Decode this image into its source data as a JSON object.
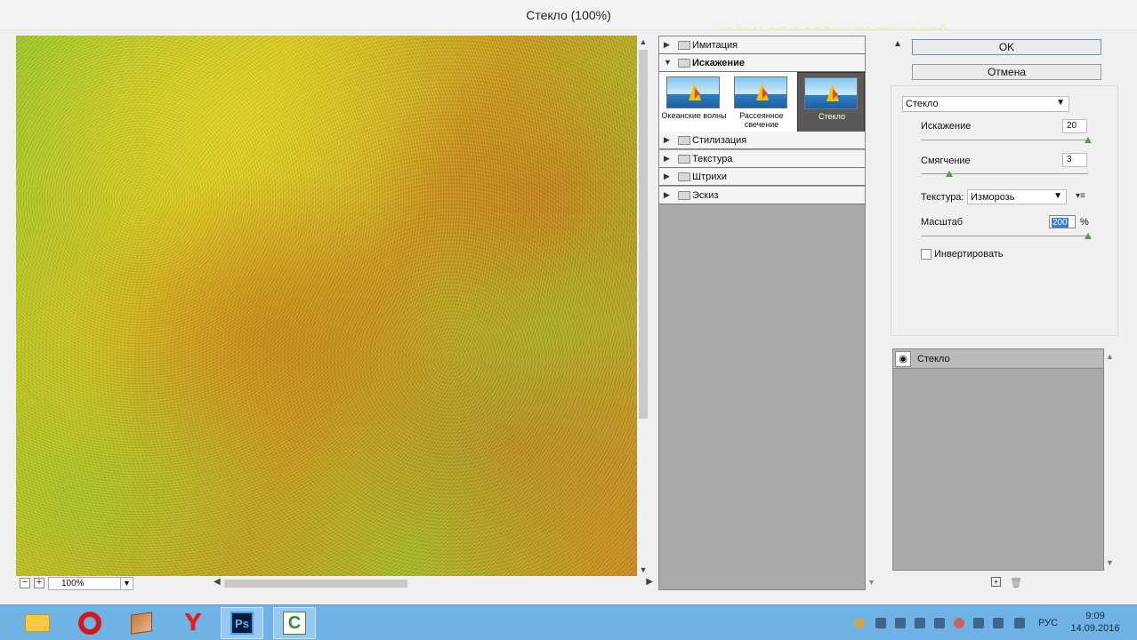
{
  "window": {
    "title": "Стекло (100%)",
    "watermark": "УРОКИ ОТ ЛЮБОВИ ТАРТАНОВОЙ"
  },
  "preview": {
    "zoom": "100%",
    "zoom_out": "−",
    "zoom_in": "+"
  },
  "gallery": {
    "categories": [
      {
        "label": "Имитация",
        "open": false
      },
      {
        "label": "Искажение",
        "open": true
      },
      {
        "label": "Стилизация",
        "open": false
      },
      {
        "label": "Текстура",
        "open": false
      },
      {
        "label": "Штрихи",
        "open": false
      },
      {
        "label": "Эскиз",
        "open": false
      }
    ],
    "thumbnails": [
      {
        "label": "Океанские волны"
      },
      {
        "label": "Рассеянное свечение"
      },
      {
        "label": "Стекло",
        "selected": true
      }
    ]
  },
  "buttons": {
    "ok": "OK",
    "cancel": "Отмена"
  },
  "settings": {
    "filter": "Стекло",
    "distortion_label": "Искажение",
    "distortion_value": "20",
    "distortion_level": 1.0,
    "smoothness_label": "Смягчение",
    "smoothness_value": "3",
    "smoothness_level": 0.15,
    "texture_label": "Текстура:",
    "texture_value": "Изморозь",
    "scale_label": "Масштаб",
    "scale_value": "200",
    "scale_unit": "%",
    "scale_level": 1.0,
    "invert_label": "Инвертировать",
    "invert_checked": false
  },
  "layers": {
    "items": [
      {
        "label": "Стекло"
      }
    ]
  },
  "taskbar": {
    "apps": [
      "explorer-icon",
      "opera-icon",
      "archive-icon",
      "yandex-icon",
      "photoshop-icon",
      "camtasia-icon"
    ],
    "photoshop_label": "Ps",
    "camtasia_label": "C",
    "yandex_label": "Y",
    "language": "РУС",
    "time": "9:09",
    "date": "14.09.2016"
  }
}
